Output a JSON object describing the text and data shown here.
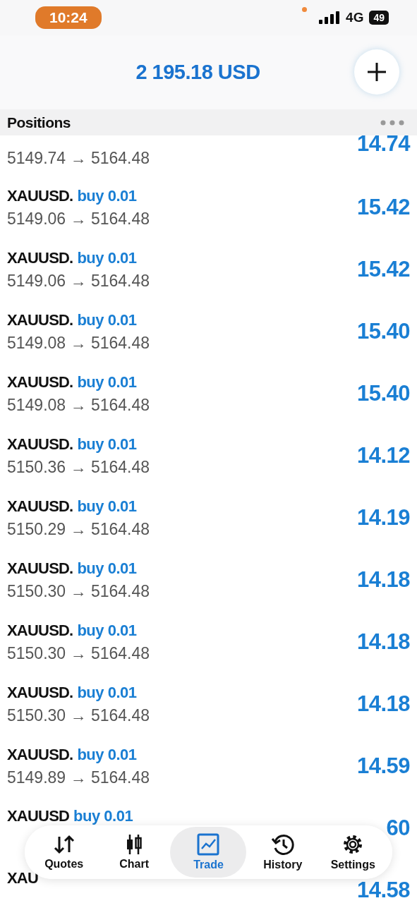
{
  "status_bar": {
    "time": "10:24",
    "network": "4G",
    "battery": "49"
  },
  "header": {
    "balance": "2 195.18 USD"
  },
  "section": {
    "title": "Positions"
  },
  "positions": [
    {
      "kind": "partial",
      "price": "5149.74 → 5164.48",
      "profit": "14.74"
    },
    {
      "kind": "full",
      "symbol": "XAUUSD.",
      "side": "buy 0.01",
      "price": "5149.06 → 5164.48",
      "profit": "15.42"
    },
    {
      "kind": "full",
      "symbol": "XAUUSD.",
      "side": "buy 0.01",
      "price": "5149.06 → 5164.48",
      "profit": "15.42"
    },
    {
      "kind": "full",
      "symbol": "XAUUSD.",
      "side": "buy 0.01",
      "price": "5149.08 → 5164.48",
      "profit": "15.40"
    },
    {
      "kind": "full",
      "symbol": "XAUUSD.",
      "side": "buy 0.01",
      "price": "5149.08 → 5164.48",
      "profit": "15.40"
    },
    {
      "kind": "full",
      "symbol": "XAUUSD.",
      "side": "buy 0.01",
      "price": "5150.36 → 5164.48",
      "profit": "14.12"
    },
    {
      "kind": "full",
      "symbol": "XAUUSD.",
      "side": "buy 0.01",
      "price": "5150.29 → 5164.48",
      "profit": "14.19"
    },
    {
      "kind": "full",
      "symbol": "XAUUSD.",
      "side": "buy 0.01",
      "price": "5150.30 → 5164.48",
      "profit": "14.18"
    },
    {
      "kind": "full",
      "symbol": "XAUUSD.",
      "side": "buy 0.01",
      "price": "5150.30 → 5164.48",
      "profit": "14.18"
    },
    {
      "kind": "full",
      "symbol": "XAUUSD.",
      "side": "buy 0.01",
      "price": "5150.30 → 5164.48",
      "profit": "14.18"
    },
    {
      "kind": "full",
      "symbol": "XAUUSD.",
      "side": "buy 0.01",
      "price": "5149.89 → 5164.48",
      "profit": "14.59"
    },
    {
      "kind": "full",
      "symbol": "XAUUSD",
      "side": "buy 0.01",
      "profit": "60"
    },
    {
      "kind": "full",
      "symbol": "XAU",
      "profit": "14.58"
    }
  ],
  "nav": [
    {
      "label": "Quotes",
      "selected": false
    },
    {
      "label": "Chart",
      "selected": false
    },
    {
      "label": "Trade",
      "selected": true
    },
    {
      "label": "History",
      "selected": false
    },
    {
      "label": "Settings",
      "selected": false
    }
  ]
}
